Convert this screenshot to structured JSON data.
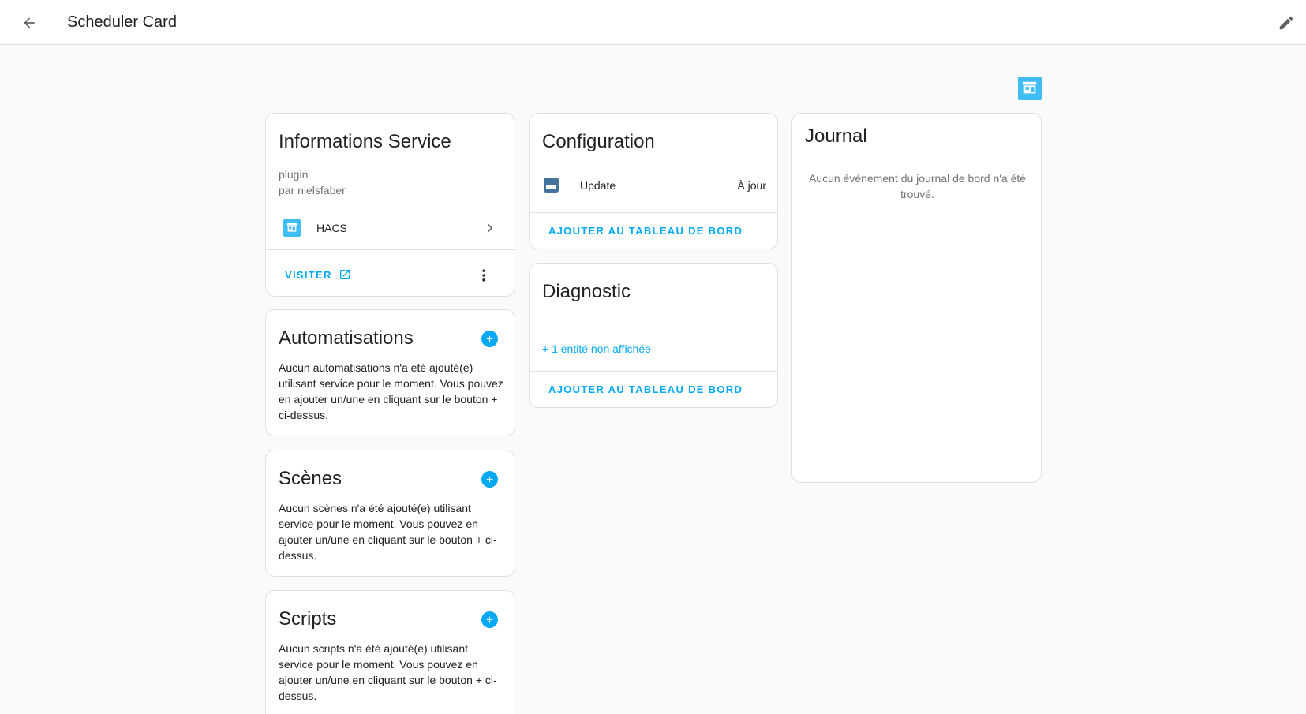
{
  "header": {
    "title": "Scheduler Card"
  },
  "info_card": {
    "title": "Informations Service",
    "type": "plugin",
    "author": "par nielsfaber",
    "integration_label": "HACS",
    "visit_label": "VISITER"
  },
  "automations_card": {
    "title": "Automatisations",
    "text": "Aucun automatisations n'a été ajouté(e) utilisant service pour le moment. Vous pouvez en ajouter un/une en cliquant sur le bouton + ci-dessus."
  },
  "scenes_card": {
    "title": "Scènes",
    "text": "Aucun scènes n'a été ajouté(e) utilisant service pour le moment. Vous pouvez en ajouter un/une en cliquant sur le bouton + ci-dessus."
  },
  "scripts_card": {
    "title": "Scripts",
    "text": "Aucun scripts n'a été ajouté(e) utilisant service pour le moment. Vous pouvez en ajouter un/une en cliquant sur le bouton + ci-dessus."
  },
  "config_card": {
    "title": "Configuration",
    "entity_name": "Update",
    "entity_state": "À jour",
    "add_dashboard_label": "AJOUTER AU TABLEAU DE BORD"
  },
  "diagnostic_card": {
    "title": "Diagnostic",
    "hidden_entities": "+ 1 entité non affichée",
    "add_dashboard_label": "AJOUTER AU TABLEAU DE BORD"
  },
  "journal_card": {
    "title": "Journal",
    "empty_text": "Aucun événement du journal de bord n'a été trouvé."
  },
  "colors": {
    "accent": "#03a9f4",
    "hacs_blue": "#41bdf5",
    "background": "#fafafa"
  }
}
